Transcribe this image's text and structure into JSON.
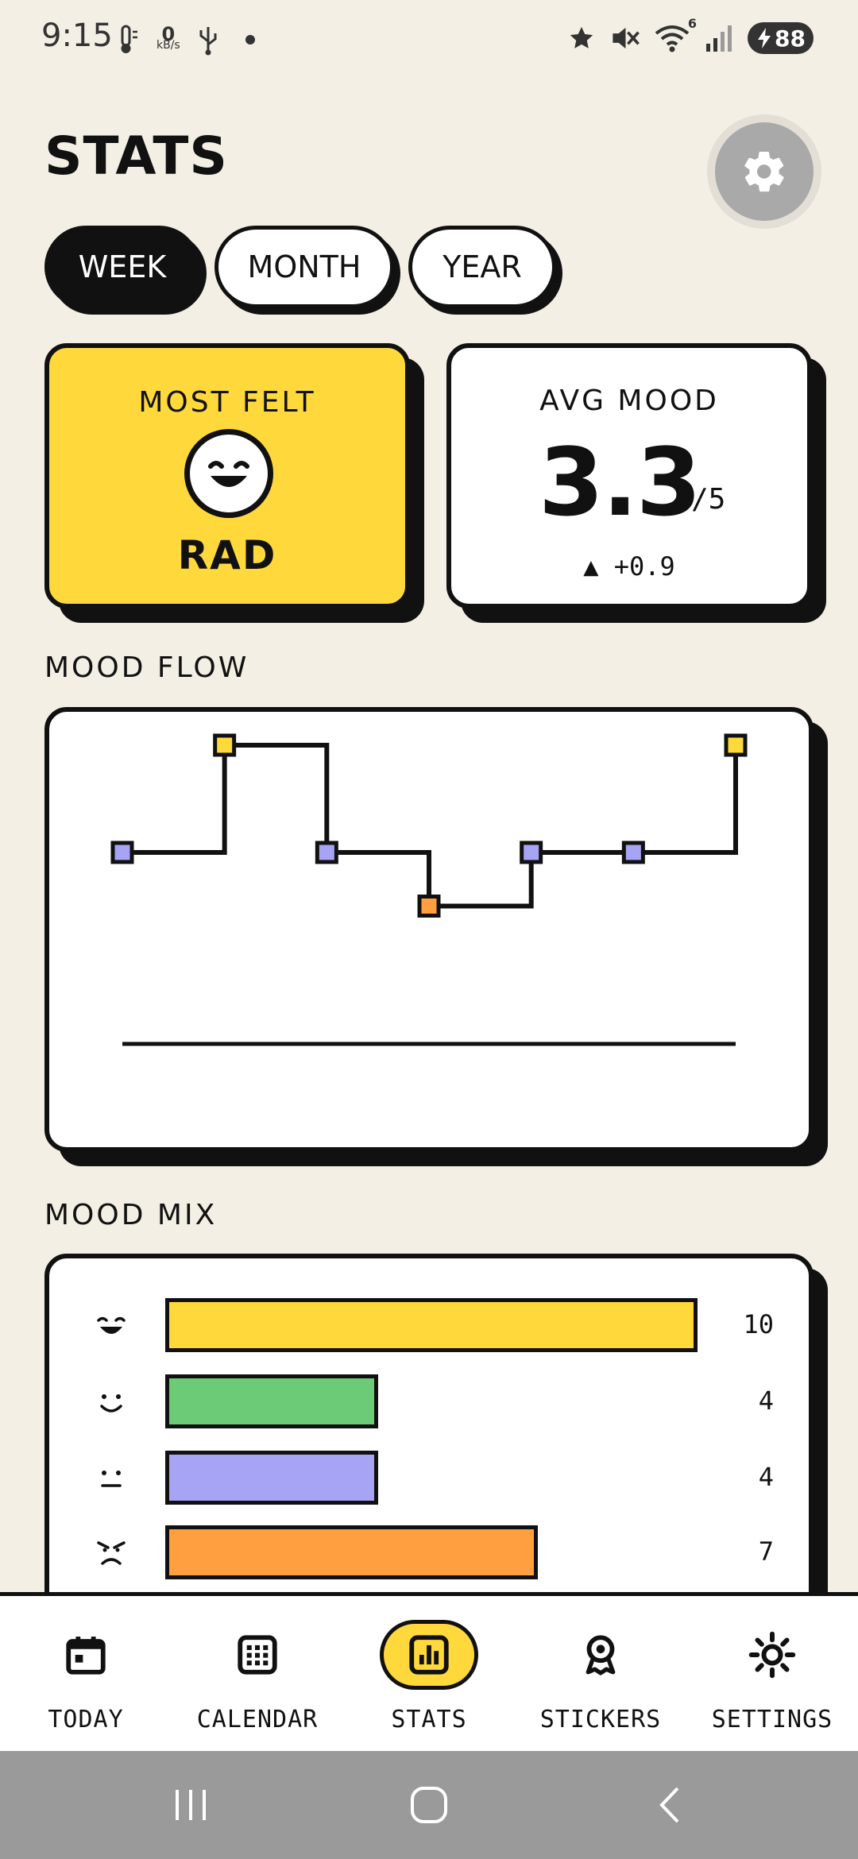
{
  "status_bar": {
    "time": "9:15",
    "kbs_value": "0",
    "kbs_unit": "kB/s",
    "battery": "88",
    "wifi_badge": "6"
  },
  "header": {
    "title": "STATS"
  },
  "tabs": [
    {
      "label": "WEEK",
      "active": true
    },
    {
      "label": "MONTH",
      "active": false
    },
    {
      "label": "YEAR",
      "active": false
    }
  ],
  "most_felt": {
    "label": "MOST FELT",
    "value": "RAD"
  },
  "avg_mood": {
    "label": "AVG MOOD",
    "value": "3.3",
    "out_of": "/5",
    "delta": "▲ +0.9"
  },
  "mood_flow": {
    "label": "MOOD FLOW"
  },
  "mood_mix": {
    "label": "MOOD MIX"
  },
  "chart_data": [
    {
      "type": "line",
      "step": true,
      "points": [
        {
          "x": 1,
          "y": 3,
          "color": "#a8a4f5"
        },
        {
          "x": 2,
          "y": 5,
          "color": "#ffd93b"
        },
        {
          "x": 3,
          "y": 3,
          "color": "#a8a4f5"
        },
        {
          "x": 4,
          "y": 2,
          "color": "#ff9f40"
        },
        {
          "x": 5,
          "y": 3,
          "color": "#a8a4f5"
        },
        {
          "x": 6,
          "y": 3,
          "color": "#a8a4f5"
        },
        {
          "x": 7,
          "y": 5,
          "color": "#ffd93b"
        }
      ],
      "ylim": [
        1,
        5
      ],
      "xlim": [
        1,
        7
      ]
    },
    {
      "type": "bar",
      "orientation": "horizontal",
      "categories": [
        "rad",
        "good",
        "meh",
        "awful"
      ],
      "values": [
        10,
        4,
        4,
        7
      ],
      "colors": [
        "#ffd93b",
        "#6ccb76",
        "#a8a4f5",
        "#ff9f40"
      ],
      "xlim": [
        0,
        10
      ]
    }
  ],
  "nav": [
    {
      "label": "TODAY",
      "icon": "calendar-day-icon",
      "active": false
    },
    {
      "label": "CALENDAR",
      "icon": "calendar-grid-icon",
      "active": false
    },
    {
      "label": "STATS",
      "icon": "bar-chart-icon",
      "active": true
    },
    {
      "label": "STICKERS",
      "icon": "badge-icon",
      "active": false
    },
    {
      "label": "SETTINGS",
      "icon": "sun-gear-icon",
      "active": false
    }
  ],
  "colors": {
    "background": "#f3efe4",
    "accent_yellow": "#ffd93b",
    "good_green": "#6ccb76",
    "meh_purple": "#a8a4f5",
    "bad_orange": "#ff9f40",
    "ink": "#111111"
  }
}
